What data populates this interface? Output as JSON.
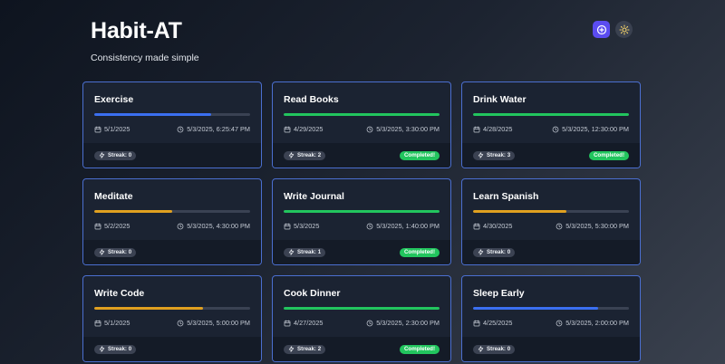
{
  "header": {
    "title": "Habit-AT",
    "subtitle": "Consistency made simple",
    "add_icon": "plus-circle-icon",
    "theme_icon": "sun-icon"
  },
  "colors": {
    "blue": "#3b6ff0",
    "green": "#22c55e",
    "amber": "#e0a020",
    "card_border": "#4b6fd0",
    "accent": "#5b4cf0"
  },
  "habits": [
    {
      "title": "Exercise",
      "progress": 0.75,
      "color": "#3b6ff0",
      "start_date": "5/1/2025",
      "last_done": "5/3/2025, 6:25:47 PM",
      "streak": "Streak: 0",
      "completed": ""
    },
    {
      "title": "Read Books",
      "progress": 1.0,
      "color": "#22c55e",
      "start_date": "4/29/2025",
      "last_done": "5/3/2025, 3:30:00 PM",
      "streak": "Streak: 2",
      "completed": "Completed!"
    },
    {
      "title": "Drink Water",
      "progress": 1.0,
      "color": "#22c55e",
      "start_date": "4/28/2025",
      "last_done": "5/3/2025, 12:30:00 PM",
      "streak": "Streak: 3",
      "completed": "Completed!"
    },
    {
      "title": "Meditate",
      "progress": 0.5,
      "color": "#e0a020",
      "start_date": "5/2/2025",
      "last_done": "5/3/2025, 4:30:00 PM",
      "streak": "Streak: 0",
      "completed": ""
    },
    {
      "title": "Write Journal",
      "progress": 1.0,
      "color": "#22c55e",
      "start_date": "5/3/2025",
      "last_done": "5/3/2025, 1:40:00 PM",
      "streak": "Streak: 1",
      "completed": "Completed!"
    },
    {
      "title": "Learn Spanish",
      "progress": 0.6,
      "color": "#e0a020",
      "start_date": "4/30/2025",
      "last_done": "5/3/2025, 5:30:00 PM",
      "streak": "Streak: 0",
      "completed": ""
    },
    {
      "title": "Write Code",
      "progress": 0.7,
      "color": "#e0a020",
      "start_date": "5/1/2025",
      "last_done": "5/3/2025, 5:00:00 PM",
      "streak": "Streak: 0",
      "completed": ""
    },
    {
      "title": "Cook Dinner",
      "progress": 1.0,
      "color": "#22c55e",
      "start_date": "4/27/2025",
      "last_done": "5/3/2025, 2:30:00 PM",
      "streak": "Streak: 2",
      "completed": "Completed!"
    },
    {
      "title": "Sleep Early",
      "progress": 0.8,
      "color": "#3b6ff0",
      "start_date": "4/25/2025",
      "last_done": "5/3/2025, 2:00:00 PM",
      "streak": "Streak: 0",
      "completed": ""
    }
  ]
}
